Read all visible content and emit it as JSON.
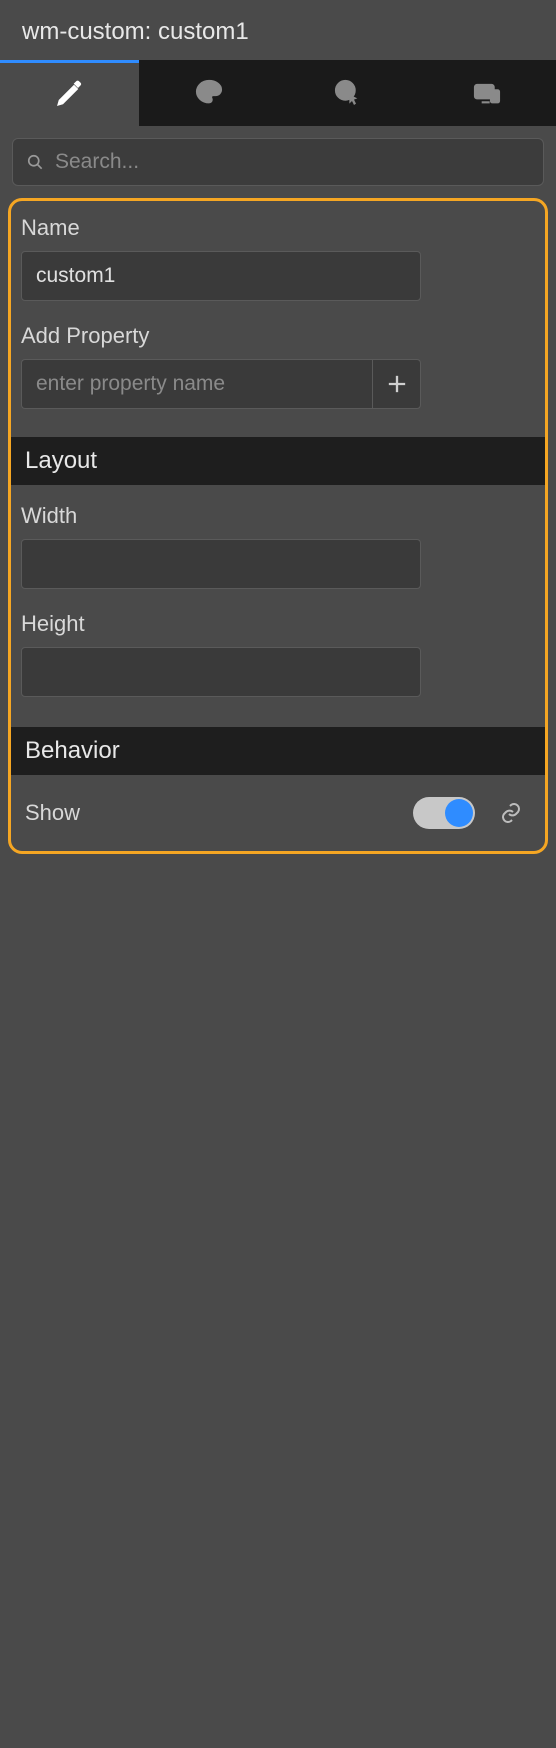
{
  "panel": {
    "title": "wm-custom: custom1"
  },
  "search": {
    "placeholder": "Search...",
    "value": ""
  },
  "props": {
    "name_label": "Name",
    "name_value": "custom1",
    "add_label": "Add Property",
    "add_placeholder": "enter property name"
  },
  "sections": {
    "layout": {
      "title": "Layout",
      "width_label": "Width",
      "width_value": "",
      "height_label": "Height",
      "height_value": ""
    },
    "behavior": {
      "title": "Behavior",
      "show_label": "Show",
      "show_value": true
    }
  },
  "icons": {
    "tab_edit": "pencil-icon",
    "tab_style": "palette-icon",
    "tab_cursor": "cursor-icon",
    "tab_device": "devices-icon",
    "search": "search-icon",
    "plus": "plus-icon",
    "link": "link-icon"
  }
}
